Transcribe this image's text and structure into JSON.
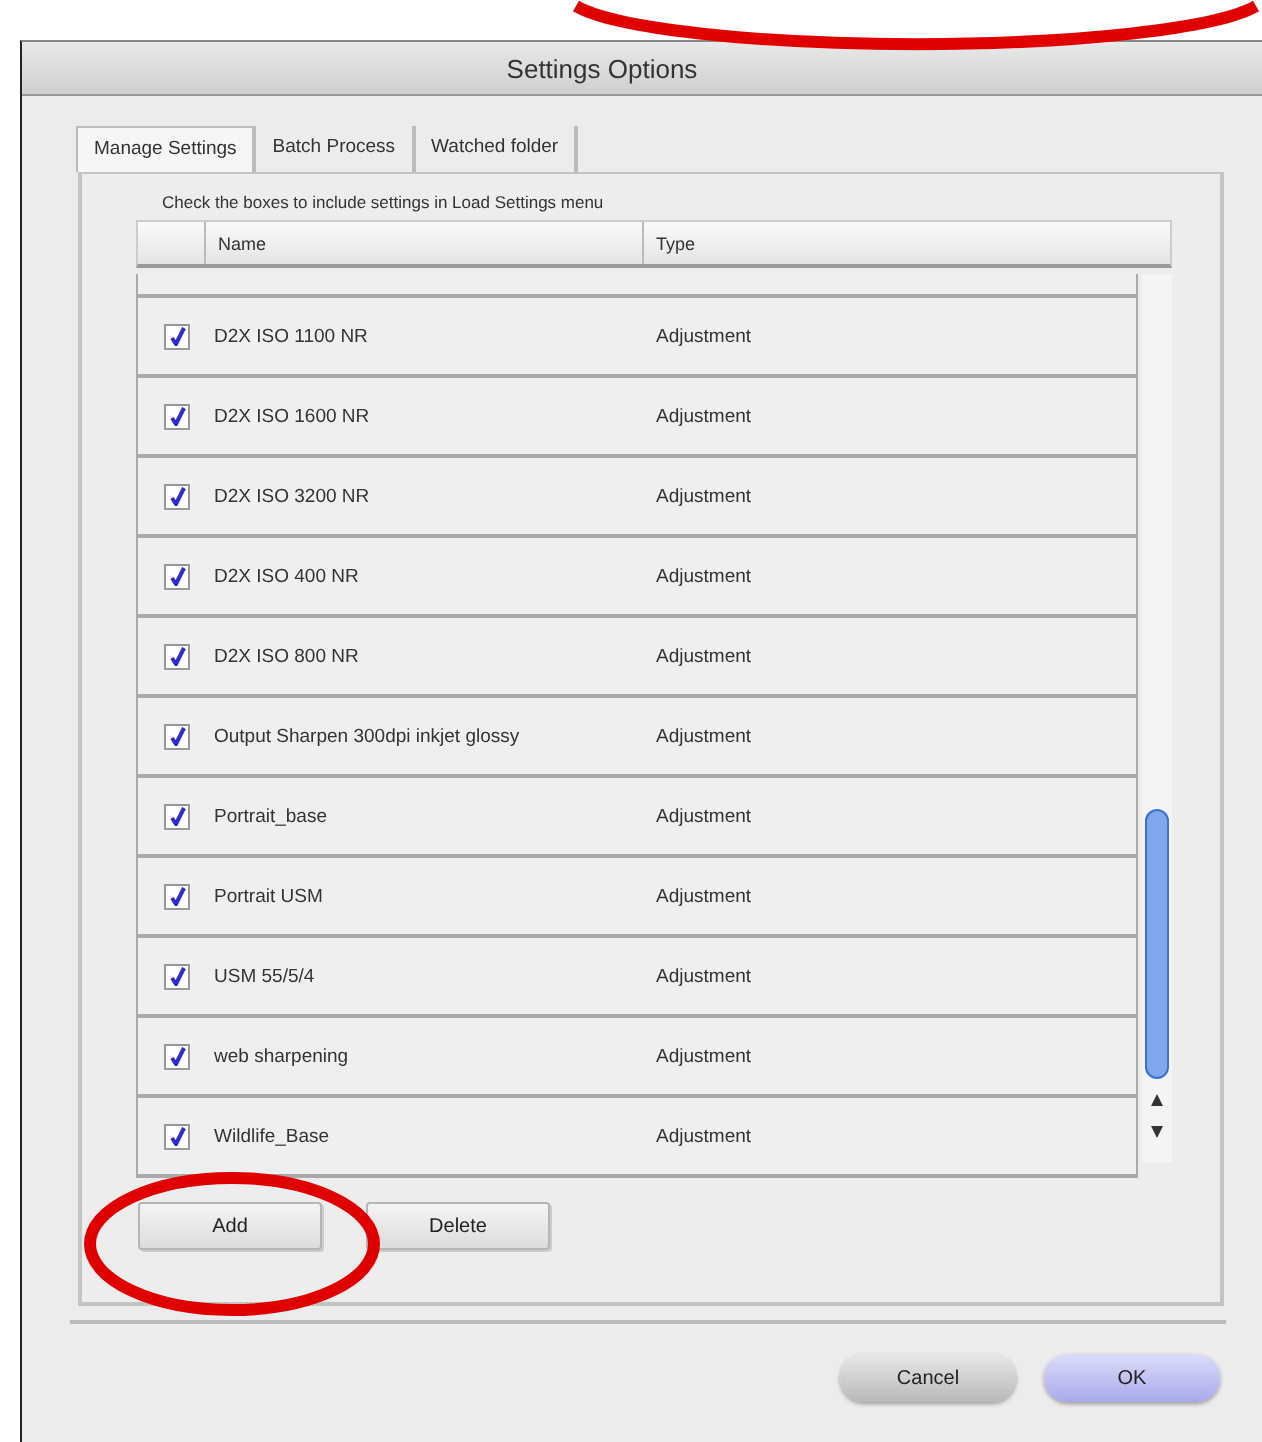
{
  "window": {
    "title": "Settings Options",
    "circled": true
  },
  "tabs": [
    {
      "label": "Manage Settings",
      "selected": true
    },
    {
      "label": "Batch Process",
      "selected": false
    },
    {
      "label": "Watched folder",
      "selected": false
    }
  ],
  "instruction": "Check the boxes to include settings in Load Settings menu",
  "table": {
    "columns": [
      "Name",
      "Type"
    ],
    "rows": [
      {
        "name": "D2X ISO 1100 NR",
        "type": "Adjustment",
        "checked": true
      },
      {
        "name": "D2X ISO 1600 NR",
        "type": "Adjustment",
        "checked": true
      },
      {
        "name": "D2X ISO 3200 NR",
        "type": "Adjustment",
        "checked": true
      },
      {
        "name": "D2X ISO 400 NR",
        "type": "Adjustment",
        "checked": true
      },
      {
        "name": "D2X ISO 800 NR",
        "type": "Adjustment",
        "checked": true
      },
      {
        "name": "Output Sharpen 300dpi inkjet glossy",
        "type": "Adjustment",
        "checked": true
      },
      {
        "name": "Portrait_base",
        "type": "Adjustment",
        "checked": true
      },
      {
        "name": "Portrait USM",
        "type": "Adjustment",
        "checked": true
      },
      {
        "name": "USM 55/5/4",
        "type": "Adjustment",
        "checked": true
      },
      {
        "name": "web sharpening",
        "type": "Adjustment",
        "checked": true
      },
      {
        "name": "Wildlife_Base",
        "type": "Adjustment",
        "checked": true
      }
    ]
  },
  "list_buttons": [
    {
      "label": "Add",
      "circled": true
    },
    {
      "label": "Delete",
      "circled": false
    }
  ],
  "dialog_buttons": [
    {
      "label": "Cancel",
      "kind": "normal"
    },
    {
      "label": "OK",
      "kind": "default"
    }
  ]
}
